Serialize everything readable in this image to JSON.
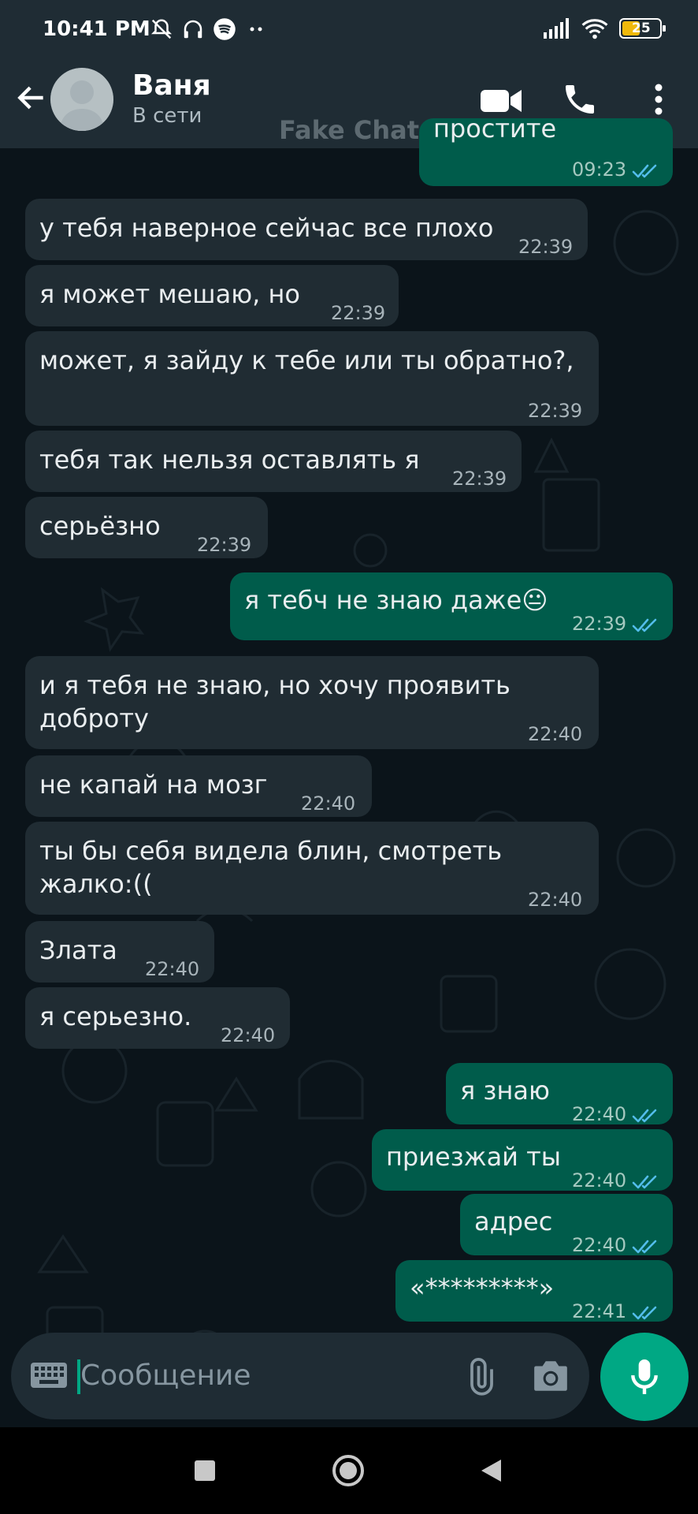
{
  "status_bar": {
    "time": "10:41 PM",
    "battery": "25",
    "icons_left": [
      "muted-bell-icon",
      "headphones-icon",
      "spotify-icon",
      "more-dots-icon"
    ],
    "icons_right": [
      "signal-icon",
      "wifi-icon",
      "battery-icon"
    ]
  },
  "header": {
    "contact_name": "Ваня",
    "contact_status": "В сети",
    "watermark": "Fake Chat",
    "icons": [
      "back-arrow-icon",
      "avatar",
      "video-call-icon",
      "phone-icon",
      "more-vert-icon"
    ]
  },
  "messages": [
    {
      "dir": "out",
      "text": "простите",
      "time": "09:23",
      "read": true
    },
    {
      "dir": "in",
      "text": "у тебя наверное сейчас все плохо",
      "time": "22:39"
    },
    {
      "dir": "in",
      "text": "я может мешаю, но",
      "time": "22:39"
    },
    {
      "dir": "in",
      "text": "может, я зайду к тебе или ты обратно?,",
      "time": "22:39"
    },
    {
      "dir": "in",
      "text": "тебя так нельзя оставлять я",
      "time": "22:39"
    },
    {
      "dir": "in",
      "text": "серьёзно",
      "time": "22:39"
    },
    {
      "dir": "out",
      "text": "я тебч не знаю даже",
      "emoji": "😐",
      "time": "22:39",
      "read": true
    },
    {
      "dir": "in",
      "text_line1": "и я тебя не знаю, но хочу проявить",
      "text_line2": "доброту",
      "time": "22:40"
    },
    {
      "dir": "in",
      "text": "не капай на мозг",
      "time": "22:40"
    },
    {
      "dir": "in",
      "text_line1": "ты бы себя видела блин, смотреть",
      "text_line2": "жалко:((",
      "time": "22:40"
    },
    {
      "dir": "in",
      "text": "Злата",
      "time": "22:40"
    },
    {
      "dir": "in",
      "text": "я серьезно.",
      "time": "22:40"
    },
    {
      "dir": "out",
      "text": "я знаю",
      "time": "22:40",
      "read": true
    },
    {
      "dir": "out",
      "text": "приезжай ты",
      "time": "22:40",
      "read": true
    },
    {
      "dir": "out",
      "text": "адрес",
      "time": "22:40",
      "read": true
    },
    {
      "dir": "out",
      "text": "«*********»",
      "time": "22:41",
      "read": true
    }
  ],
  "composer": {
    "placeholder": "Сообщение",
    "icons": [
      "keyboard-icon",
      "attach-icon",
      "camera-icon",
      "mic-icon"
    ]
  },
  "nav_bar": {
    "icons": [
      "recents-square-icon",
      "home-circle-icon",
      "back-triangle-icon"
    ]
  },
  "colors": {
    "bg": "#0b141a",
    "header": "#1f2c34",
    "incoming_bubble": "#202c33",
    "outgoing_bubble": "#005c4b",
    "accent": "#00a884",
    "read_tick": "#53bdeb"
  }
}
